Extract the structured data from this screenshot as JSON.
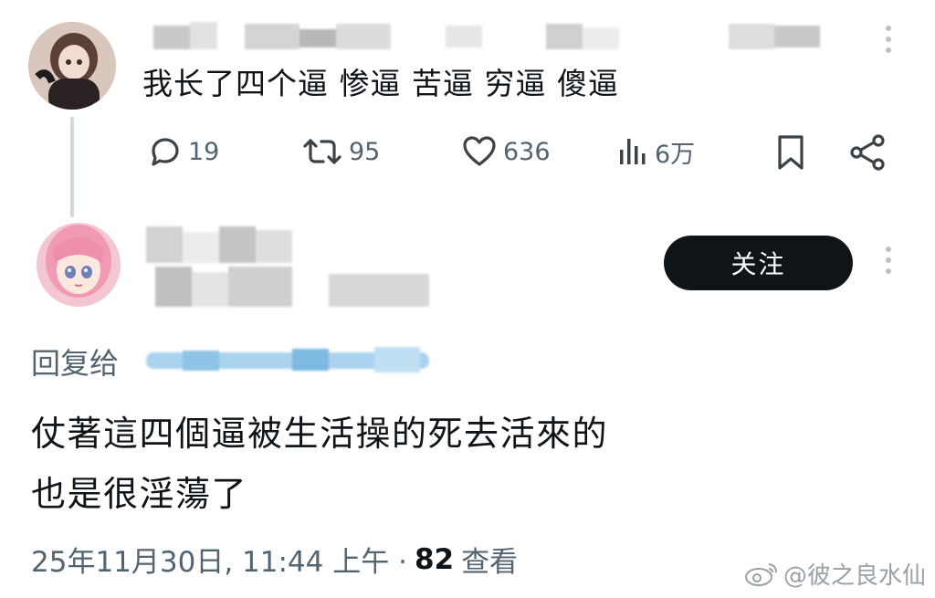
{
  "parent_tweet": {
    "text": "我长了四个逼 惨逼 苦逼 穷逼 傻逼",
    "stats": {
      "replies": "19",
      "retweets": "95",
      "likes": "636",
      "views": "6万"
    }
  },
  "reply": {
    "follow_label": "关注",
    "reply_to_prefix": "回复给",
    "text_line1": "仗著這四個逼被生活操的死去活來的",
    "text_line2": "也是很淫蕩了",
    "timestamp": "25年11月30日, 11:44 上午 ·",
    "view_count": "82",
    "view_label": "查看"
  },
  "watermark": {
    "text": "@彼之良水仙"
  },
  "colors": {
    "text": "#0f1419",
    "secondary": "#536471",
    "button_bg": "#0f1419",
    "thread_line": "#cfd9de",
    "blurred_handle": "#a9d3ee"
  },
  "icons": [
    "comment-icon",
    "retweet-icon",
    "heart-icon",
    "views-icon",
    "bookmark-icon",
    "share-icon",
    "more-icon"
  ]
}
